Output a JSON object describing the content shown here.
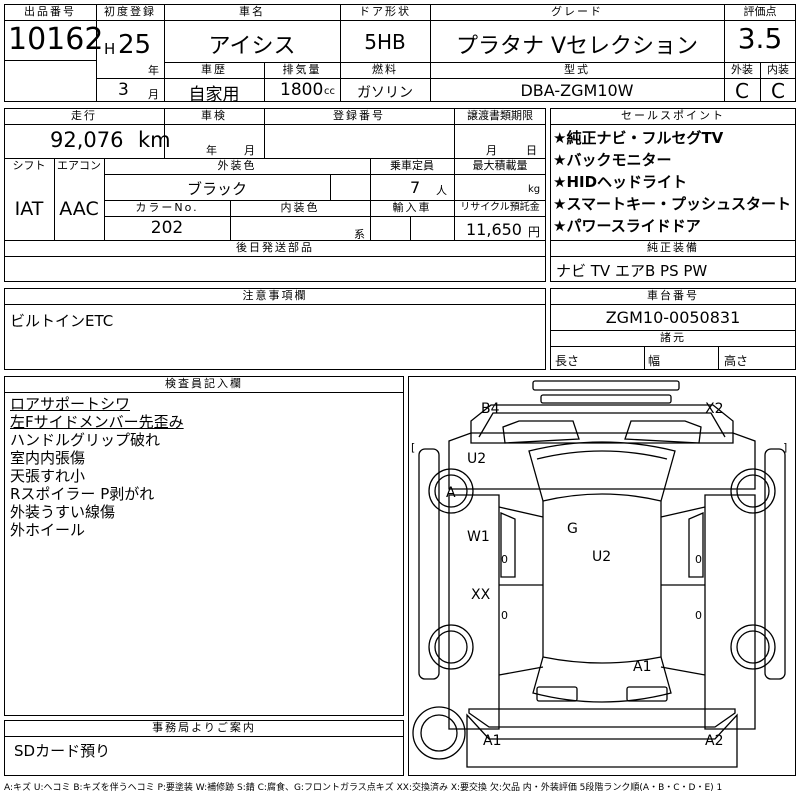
{
  "header": {
    "lot_no_label": "出品番号",
    "lot_no": "10162",
    "first_reg_label": "初度登録",
    "era": "H",
    "reg_year": "25",
    "year_unit": "年",
    "reg_month": "3",
    "month_unit": "月",
    "car_name_label": "車名",
    "car_name": "アイシス",
    "door_label": "ドア形状",
    "door": "5HB",
    "grade_label": "グレード",
    "grade": "プラタナ Vセレクション",
    "score_label": "評価点",
    "score": "3.5",
    "history_label": "車歴",
    "history": "自家用",
    "displacement_label": "排気量",
    "displacement": "1800",
    "displacement_unit": "cc",
    "fuel_label": "燃料",
    "fuel": "ガソリン",
    "model_code_label": "型式",
    "model_code": "DBA-ZGM10W",
    "exterior_grade_label": "外装",
    "exterior_grade": "C",
    "interior_grade_label": "内装",
    "interior_grade": "C"
  },
  "row2": {
    "mileage_label": "走行",
    "mileage": "92,076",
    "mileage_unit": "km",
    "inspection_label": "車検",
    "insp_year_unit": "年",
    "insp_month_unit": "月",
    "plate_label": "登録番号",
    "transfer_label": "譲渡書類期限",
    "transfer_month_unit": "月",
    "transfer_day_unit": "日",
    "shift_label": "シフト",
    "shift": "IAT",
    "ac_label": "エアコン",
    "ac": "AAC",
    "ext_color_label": "外装色",
    "ext_color": "ブラック",
    "capacity_label": "乗車定員",
    "capacity": "7",
    "capacity_unit": "人",
    "max_load_label": "最大積載量",
    "max_load_unit": "kg",
    "color_no_label": "カラーNo.",
    "color_no": "202",
    "int_color_label": "内装色",
    "int_color_unit": "系",
    "import_label": "輸入車",
    "recycle_label": "リサイクル預託金",
    "recycle": "11,650",
    "recycle_unit": "円",
    "later_parts_label": "後日発送部品"
  },
  "sales_points": {
    "label": "セールスポイント",
    "items": [
      "★純正ナビ・フルセグTV",
      "★バックモニター",
      "★HIDヘッドライト",
      "★スマートキー・プッシュスタート",
      "★パワースライドドア"
    ]
  },
  "equipment": {
    "label": "純正装備",
    "value": "ナビ TV エアB PS PW"
  },
  "caution": {
    "label": "注意事項欄",
    "value": "ビルトインETC"
  },
  "chassis": {
    "label": "車台番号",
    "value": "ZGM10-0050831"
  },
  "dimensions": {
    "label": "諸元",
    "length_label": "長さ",
    "width_label": "幅",
    "height_label": "高さ"
  },
  "inspector": {
    "label": "検査員記入欄",
    "items": [
      {
        "text": "ロアサポートシワ",
        "underline": true
      },
      {
        "text": "左Fサイドメンバー先歪み",
        "underline": true
      },
      {
        "text": "ハンドルグリップ破れ",
        "underline": false
      },
      {
        "text": "室内内張傷",
        "underline": false
      },
      {
        "text": "天張すれ小",
        "underline": false
      },
      {
        "text": "Rスポイラー P剥がれ",
        "underline": false
      },
      {
        "text": "外装うすい線傷",
        "underline": false
      },
      {
        "text": "外ホイール",
        "underline": false
      }
    ]
  },
  "office": {
    "label": "事務局よりご案内",
    "value": "SDカード預り"
  },
  "diagram": {
    "marks": {
      "b4": "B4",
      "x2": "X2",
      "u2_top": "U2",
      "a_left": "A",
      "w1": "W1",
      "g": "G",
      "u2_center": "U2",
      "xx": "XX",
      "a1_rear": "A1",
      "a1_bottom": "A1",
      "a2_bottom": "A2",
      "zero_1": "0",
      "zero_2": "0",
      "zero_3": "0",
      "zero_4": "0",
      "bracket_l": "[",
      "bracket_r": "]"
    }
  },
  "legend": "A:キズ U:ヘコミ B:キズを伴うヘコミ P:要塗装 W:補修跡 S:錆 C:腐食、G:フロントガラス点キズ XX:交換済み X:要交換 欠:欠品 内・外装評価 5段階ランク順(A・B・C・D・E) 1"
}
